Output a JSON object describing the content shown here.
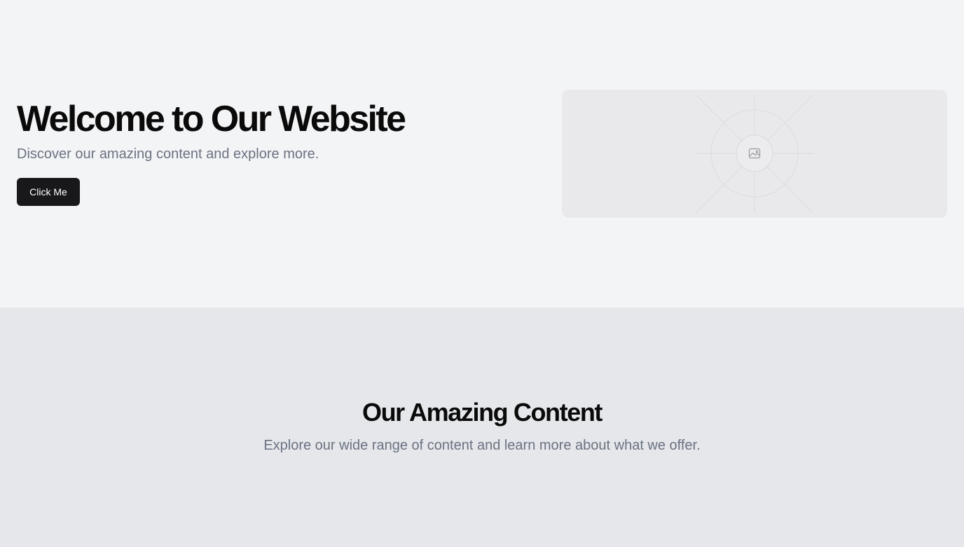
{
  "hero": {
    "title": "Welcome to Our Website",
    "subtitle": "Discover our amazing content and explore more.",
    "button_label": "Click Me",
    "image_icon": "image-icon"
  },
  "content": {
    "title": "Our Amazing Content",
    "subtitle": "Explore our wide range of content and learn more about what we offer."
  },
  "colors": {
    "hero_bg": "#f3f4f6",
    "content_bg": "#e5e7eb",
    "button_bg": "#18181b",
    "muted_text": "#6b7280"
  }
}
